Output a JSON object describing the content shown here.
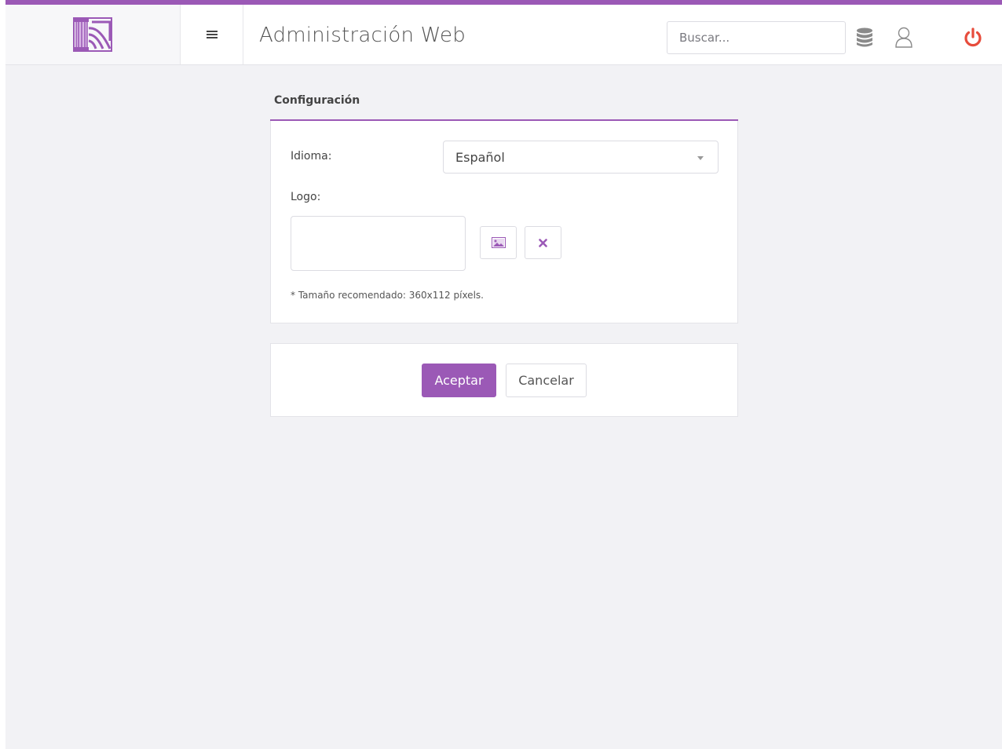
{
  "colors": {
    "accent": "#9b59b6",
    "power": "#e74c3c",
    "background": "#f2f2f5"
  },
  "header": {
    "title": "Administración Web",
    "search_placeholder": "Buscar...",
    "icons": [
      "logo-icon",
      "menu-icon",
      "database-icon",
      "user-icon",
      "power-icon"
    ]
  },
  "config": {
    "title": "Configuración",
    "language_label": "Idioma:",
    "language_value": "Español",
    "logo_label": "Logo:",
    "hint": "* Tamaño recomendado: 360x112 píxels."
  },
  "actions": {
    "accept_label": "Aceptar",
    "cancel_label": "Cancelar"
  }
}
